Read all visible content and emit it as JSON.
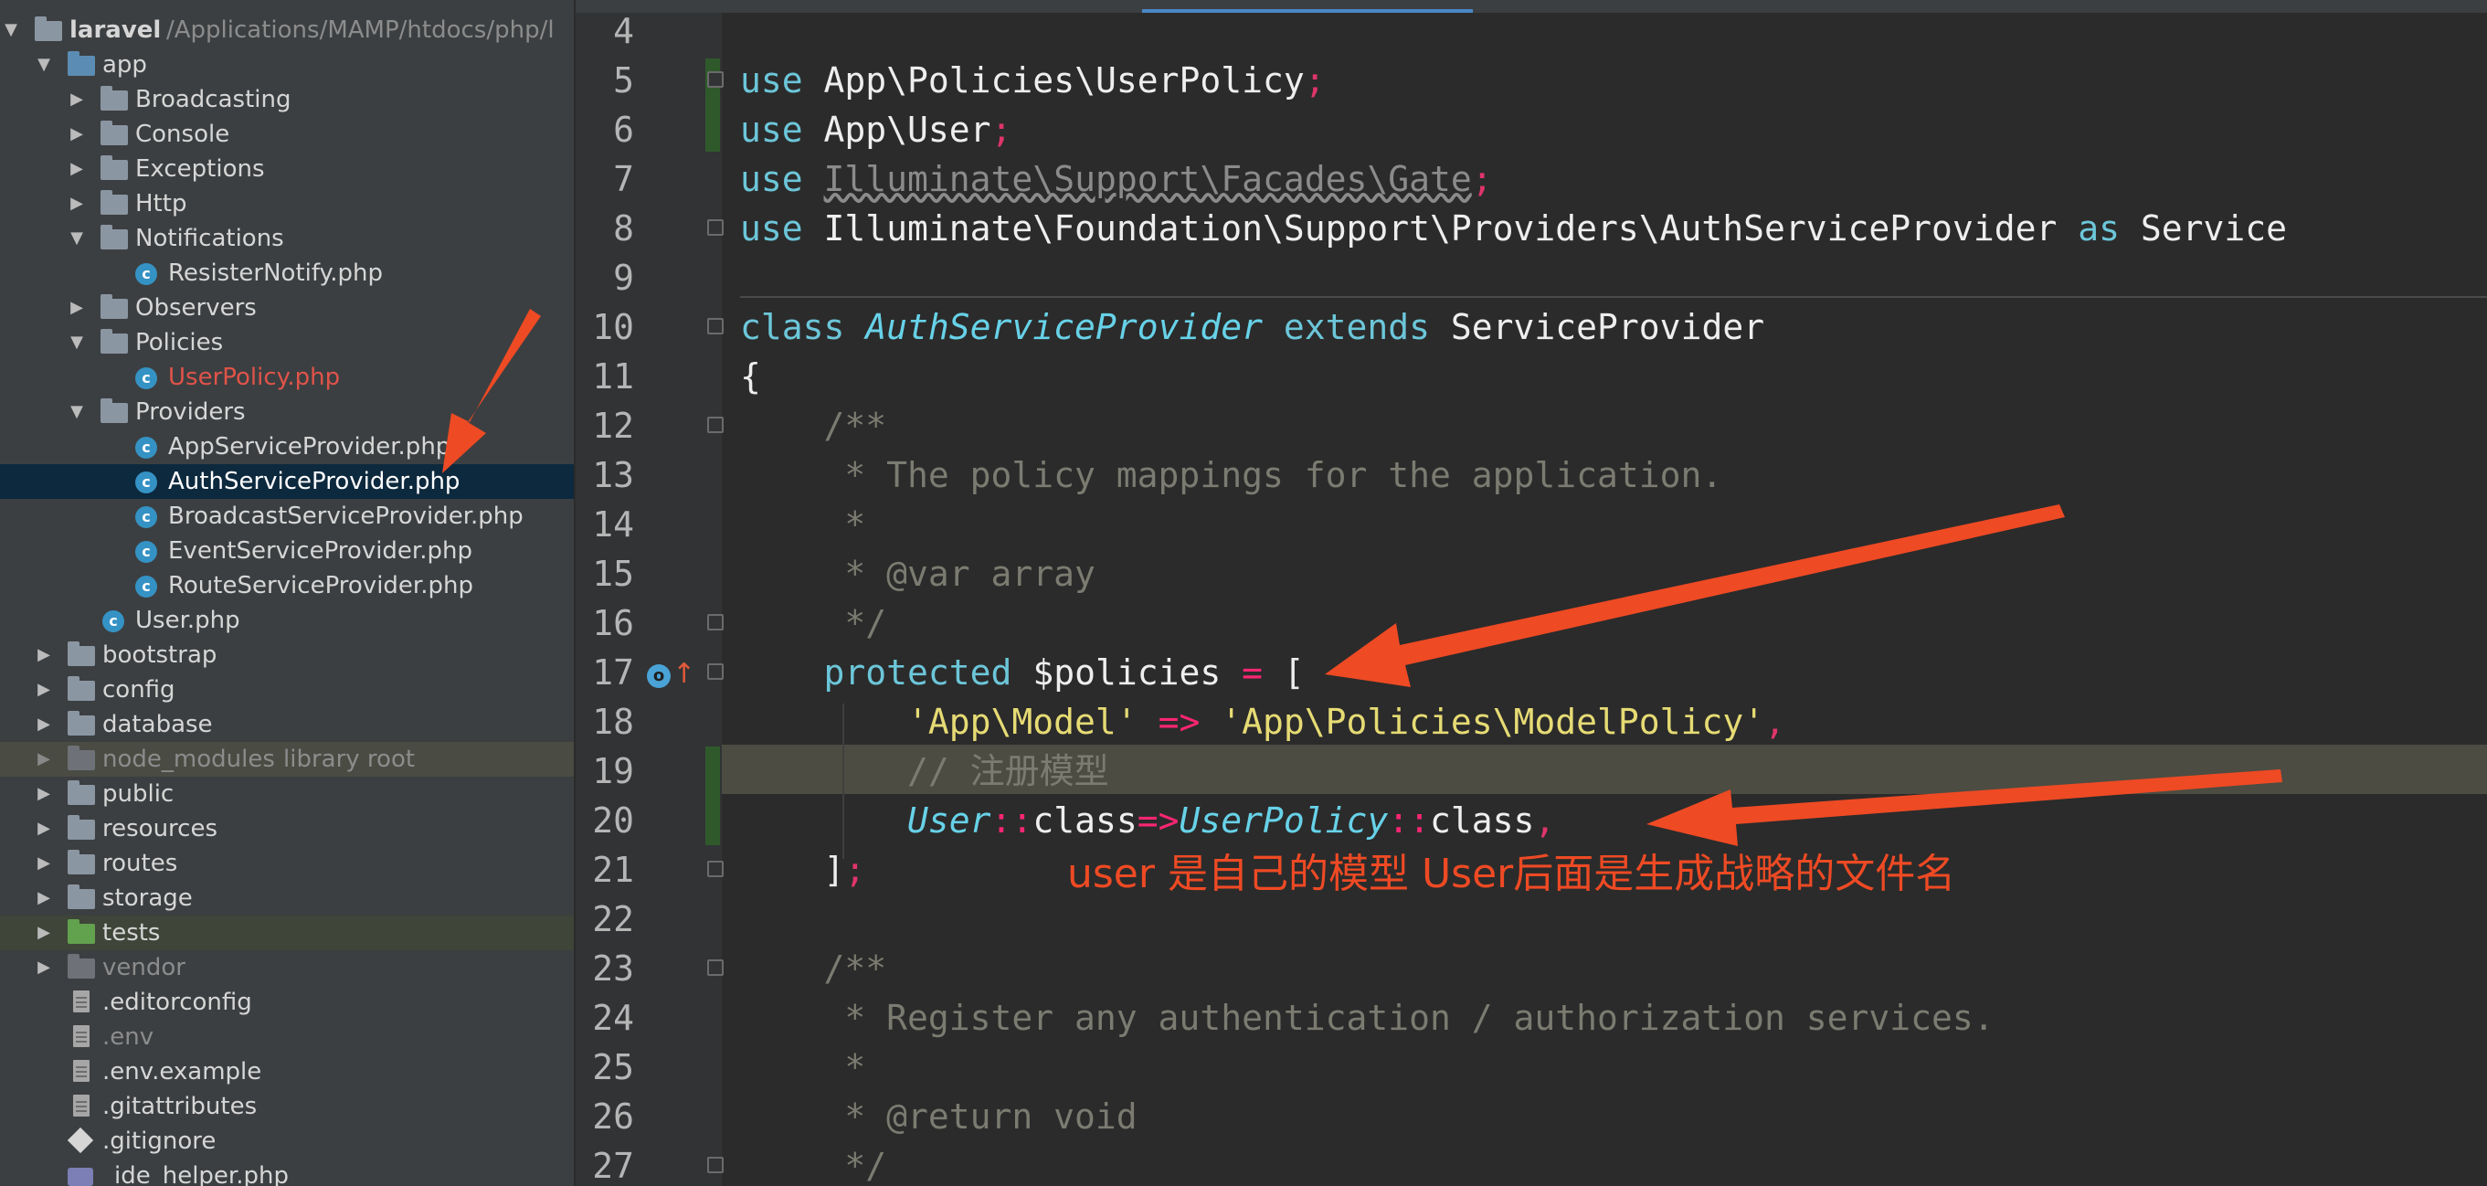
{
  "project_tree": {
    "root": {
      "label": "laravel",
      "path": "/Applications/MAMP/htdocs/php/l"
    },
    "items": [
      {
        "label": "app",
        "kind": "folder",
        "color": "blue",
        "expanded": true
      },
      {
        "label": "Broadcasting",
        "kind": "folder",
        "expanded": false
      },
      {
        "label": "Console",
        "kind": "folder",
        "expanded": false
      },
      {
        "label": "Exceptions",
        "kind": "folder",
        "expanded": false
      },
      {
        "label": "Http",
        "kind": "folder",
        "expanded": false
      },
      {
        "label": "Notifications",
        "kind": "folder",
        "expanded": true
      },
      {
        "label": "ResisterNotify.php",
        "kind": "class"
      },
      {
        "label": "Observers",
        "kind": "folder",
        "expanded": false
      },
      {
        "label": "Policies",
        "kind": "folder",
        "expanded": true
      },
      {
        "label": "UserPolicy.php",
        "kind": "class",
        "status": "unversioned"
      },
      {
        "label": "Providers",
        "kind": "folder",
        "expanded": true
      },
      {
        "label": "AppServiceProvider.php",
        "kind": "class"
      },
      {
        "label": "AuthServiceProvider.php",
        "kind": "class",
        "selected": true
      },
      {
        "label": "BroadcastServiceProvider.php",
        "kind": "class"
      },
      {
        "label": "EventServiceProvider.php",
        "kind": "class"
      },
      {
        "label": "RouteServiceProvider.php",
        "kind": "class"
      },
      {
        "label": "User.php",
        "kind": "class"
      },
      {
        "label": "bootstrap",
        "kind": "folder",
        "expanded": false
      },
      {
        "label": "config",
        "kind": "folder",
        "expanded": false
      },
      {
        "label": "database",
        "kind": "folder",
        "expanded": false
      },
      {
        "label": "node_modules",
        "sublabel": "library root",
        "kind": "folder",
        "expanded": false
      },
      {
        "label": "public",
        "kind": "folder",
        "expanded": false
      },
      {
        "label": "resources",
        "kind": "folder",
        "expanded": false
      },
      {
        "label": "routes",
        "kind": "folder",
        "expanded": false
      },
      {
        "label": "storage",
        "kind": "folder",
        "expanded": false
      },
      {
        "label": "tests",
        "kind": "folder",
        "color": "green",
        "expanded": false
      },
      {
        "label": "vendor",
        "kind": "folder",
        "expanded": false
      },
      {
        "label": ".editorconfig",
        "kind": "file"
      },
      {
        "label": ".env",
        "kind": "file"
      },
      {
        "label": ".env.example",
        "kind": "file"
      },
      {
        "label": ".gitattributes",
        "kind": "file"
      },
      {
        "label": ".gitignore",
        "kind": "git-file"
      },
      {
        "label": "_ide_helper.php",
        "kind": "php-file"
      }
    ]
  },
  "editor": {
    "line_numbers": [
      "4",
      "5",
      "6",
      "7",
      "8",
      "9",
      "10",
      "11",
      "12",
      "13",
      "14",
      "15",
      "16",
      "17",
      "18",
      "19",
      "20",
      "21",
      "22",
      "23",
      "24",
      "25",
      "26",
      "27"
    ],
    "code": {
      "l5": {
        "kw": "use",
        "rest": "App\\Policies\\UserPolicy",
        "semi": ";"
      },
      "l6": {
        "kw": "use",
        "rest": "App\\User",
        "semi": ";"
      },
      "l7": {
        "kw": "use",
        "rest": "Illuminate\\Support\\Facades\\Gate",
        "semi": ";"
      },
      "l8": {
        "kw": "use",
        "rest": "Illuminate\\Foundation\\Support\\Providers\\AuthServiceProvider",
        "kw2": "as",
        "rest2": "Service"
      },
      "l10": {
        "kw": "class",
        "name": "AuthServiceProvider",
        "kw2": "extends",
        "rest": "ServiceProvider"
      },
      "l11": "{",
      "l12": "    /**",
      "l13": "     * The policy mappings for the application.",
      "l14": "     *",
      "l15": "     * @var array",
      "l16": "     */",
      "l17": {
        "kw": "protected",
        "var": "$policies",
        "op": "=",
        "bracket": "["
      },
      "l18": {
        "str1": "'App\\Model'",
        "op": "=>",
        "str2": "'App\\Policies\\ModelPolicy'",
        "semi": ","
      },
      "l19": "// 注册模型",
      "l20": {
        "cls1": "User",
        "sep1": "::",
        "k1": "class",
        "op": "=>",
        "cls2": "UserPolicy",
        "sep2": "::",
        "k2": "class",
        "semi": ","
      },
      "l21": {
        "bracket": "]",
        "semi": ";"
      },
      "l23": "    /**",
      "l24": "     * Register any authentication / authorization services.",
      "l25": "     *",
      "l26": "     * @return void",
      "l27": "     */"
    },
    "gutter_icon_letter": "o"
  },
  "annotation": {
    "text": "user 是自己的模型  User后面是生成战略的文件名",
    "color": "#ee4a24"
  }
}
